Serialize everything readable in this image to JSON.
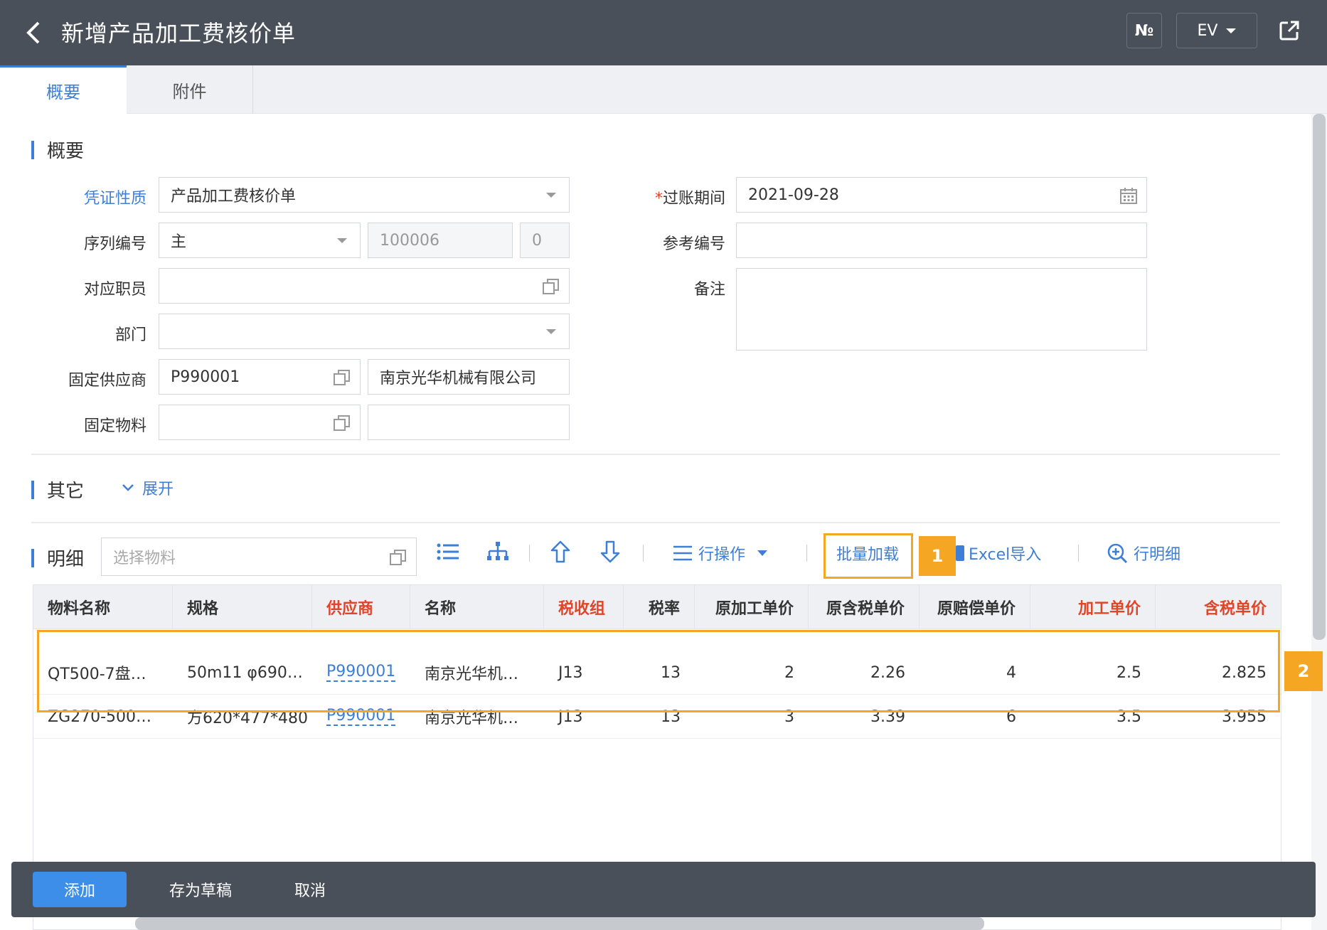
{
  "header": {
    "title": "新增产品加工费核价单",
    "no_label": "№",
    "ev_label": "EV"
  },
  "tabs": [
    {
      "label": "概要"
    },
    {
      "label": "附件"
    }
  ],
  "overview": {
    "section_title": "概要",
    "voucher_type_label": "凭证性质",
    "voucher_type_value": "产品加工费核价单",
    "serial_label": "序列编号",
    "serial_value": "主",
    "serial_number": "100006",
    "serial_suffix": "0",
    "employee_label": "对应职员",
    "department_label": "部门",
    "supplier_label": "固定供应商",
    "supplier_code": "P990001",
    "supplier_name": "南京光华机械有限公司",
    "material_label": "固定物料",
    "posting_period_label": "过账期间",
    "posting_period_required": "*",
    "posting_period_value": "2021-09-28",
    "reference_label": "参考编号",
    "remark_label": "备注"
  },
  "other": {
    "section_title": "其它",
    "expand_label": "展开"
  },
  "detail": {
    "section_title": "明细",
    "material_placeholder": "选择物料",
    "row_ops_label": "行操作",
    "batch_load_label": "批量加载",
    "excel_import_label": "Excel导入",
    "row_detail_label": "行明细",
    "marker_1": "1",
    "marker_2": "2",
    "columns": [
      "物料名称",
      "规格",
      "供应商",
      "名称",
      "税收组",
      "税率",
      "原加工单价",
      "原含税单价",
      "原赔偿单价",
      "加工单价",
      "含税单价"
    ],
    "rows": [
      [
        "QT500-7盘…",
        "50m11 φ690…",
        "P990001",
        "南京光华机…",
        "J13",
        "13",
        "2",
        "2.26",
        "4",
        "2.5",
        "2.825"
      ],
      [
        "ZG270-500…",
        "方620*477*480",
        "P990001",
        "南京光华机…",
        "J13",
        "13",
        "3",
        "3.39",
        "6",
        "3.5",
        "3.955"
      ]
    ]
  },
  "footer": {
    "add_label": "添加",
    "draft_label": "存为草稿",
    "cancel_label": "取消"
  },
  "colors": {
    "accent": "#3d7fd6",
    "header_bg": "#4a5059",
    "highlight": "#f5a623",
    "required_red": "#e0452a"
  }
}
